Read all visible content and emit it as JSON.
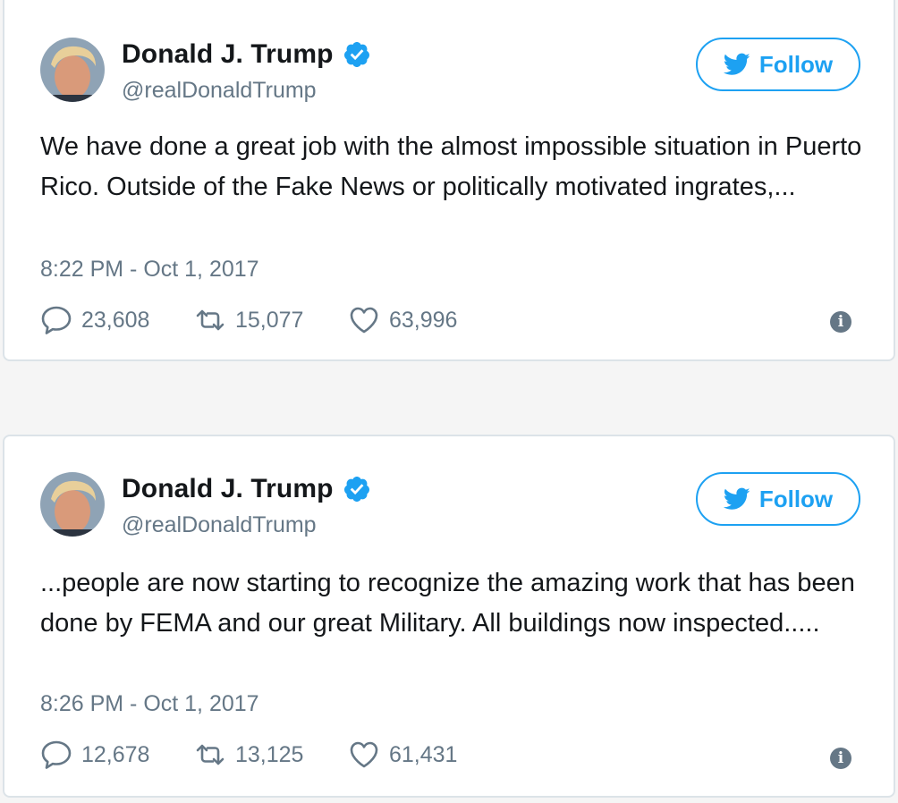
{
  "colors": {
    "accent": "#1da1f2",
    "verified": "#1da1f2",
    "muted": "#657786",
    "text": "#14171a",
    "border": "#dce3e8",
    "background": "#f5f5f5"
  },
  "tweets": [
    {
      "author": {
        "name": "Donald J. Trump",
        "handle": "@realDonaldTrump",
        "verified_icon": "verified-badge-icon",
        "avatar_icon": "avatar-photo"
      },
      "follow_label": "Follow",
      "text": "We have done a great job with the almost impossible situation in Puerto Rico. Outside of the Fake News or politically motivated ingrates,...",
      "timestamp": "8:22 PM - Oct 1, 2017",
      "stats": {
        "replies": "23,608",
        "retweets": "15,077",
        "likes": "63,996"
      },
      "info_icon": "info-icon"
    },
    {
      "author": {
        "name": "Donald J. Trump",
        "handle": "@realDonaldTrump",
        "verified_icon": "verified-badge-icon",
        "avatar_icon": "avatar-photo"
      },
      "follow_label": "Follow",
      "text": "...people are now starting to recognize the amazing work that has been done by FEMA and our great Military. All buildings now inspected.....",
      "timestamp": "8:26 PM - Oct 1, 2017",
      "stats": {
        "replies": "12,678",
        "retweets": "13,125",
        "likes": "61,431"
      },
      "info_icon": "info-icon"
    }
  ]
}
